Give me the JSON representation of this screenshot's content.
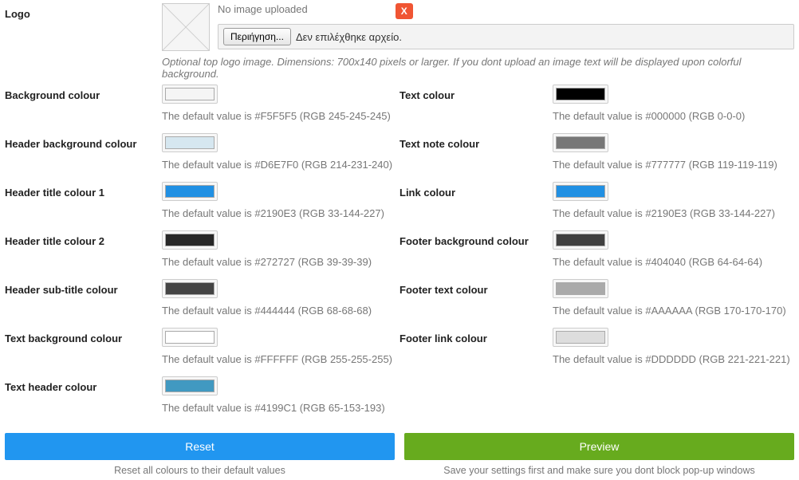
{
  "logo": {
    "label": "Logo",
    "no_image": "No image uploaded",
    "x": "X",
    "browse": "Περιήγηση...",
    "no_file": "Δεν επιλέχθηκε αρχείο.",
    "hint": "Optional top logo image. Dimensions: 700x140 pixels or larger. If you dont upload an image text will be displayed upon colorful background."
  },
  "left": [
    {
      "label": "Background colour",
      "swatch": "#F5F5F5",
      "hint": "The default value is #F5F5F5 (RGB 245-245-245)"
    },
    {
      "label": "Header background colour",
      "swatch": "#D6E7F0",
      "hint": "The default value is #D6E7F0 (RGB 214-231-240)"
    },
    {
      "label": "Header title colour 1",
      "swatch": "#2190E3",
      "hint": "The default value is #2190E3 (RGB 33-144-227)"
    },
    {
      "label": "Header title colour 2",
      "swatch": "#272727",
      "hint": "The default value is #272727 (RGB 39-39-39)"
    },
    {
      "label": "Header sub-title colour",
      "swatch": "#444444",
      "hint": "The default value is #444444 (RGB 68-68-68)"
    },
    {
      "label": "Text background colour",
      "swatch": "#FFFFFF",
      "hint": "The default value is #FFFFFF (RGB 255-255-255)"
    },
    {
      "label": "Text header colour",
      "swatch": "#4199C1",
      "hint": "The default value is #4199C1 (RGB 65-153-193)"
    }
  ],
  "right": [
    {
      "label": "Text colour",
      "swatch": "#000000",
      "hint": "The default value is #000000 (RGB 0-0-0)"
    },
    {
      "label": "Text note colour",
      "swatch": "#777777",
      "hint": "The default value is #777777 (RGB 119-119-119)"
    },
    {
      "label": "Link colour",
      "swatch": "#2190E3",
      "hint": "The default value is #2190E3 (RGB 33-144-227)"
    },
    {
      "label": "Footer background colour",
      "swatch": "#404040",
      "hint": "The default value is #404040 (RGB 64-64-64)"
    },
    {
      "label": "Footer text colour",
      "swatch": "#AAAAAA",
      "hint": "The default value is #AAAAAA (RGB 170-170-170)"
    },
    {
      "label": "Footer link colour",
      "swatch": "#DDDDDD",
      "hint": "The default value is #DDDDDD (RGB 221-221-221)"
    }
  ],
  "buttons": {
    "reset": "Reset",
    "reset_hint": "Reset all colours to their default values",
    "preview": "Preview",
    "preview_hint": "Save your settings first and make sure you dont block pop-up windows"
  }
}
